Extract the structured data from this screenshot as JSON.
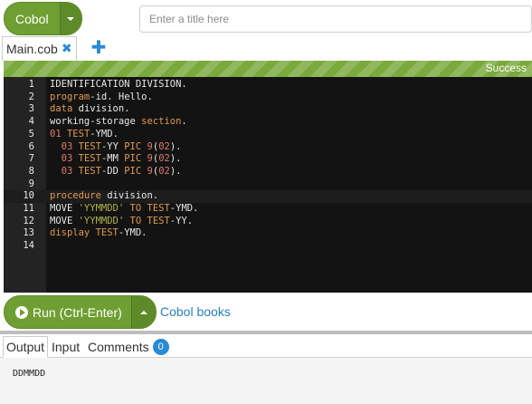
{
  "toolbar": {
    "language_label": "Cobol",
    "title_placeholder": "Enter a title here"
  },
  "tabs": {
    "file_name": "Main.cob",
    "close_glyph": "✖",
    "add_glyph": "✚"
  },
  "status": {
    "text": "Success",
    "color": "#7aa93c"
  },
  "editor": {
    "line_numbers": [
      "1",
      "2",
      "3",
      "4",
      "5",
      "6",
      "7",
      "8",
      "9",
      "10",
      "11",
      "12",
      "13",
      "14"
    ],
    "active_line": 10
  },
  "run": {
    "label": "Run (Ctrl-Enter)",
    "books_link": "Cobol books"
  },
  "output_tabs": {
    "output": "Output",
    "input": "Input",
    "comments": "Comments",
    "comments_count": "0"
  },
  "output": {
    "text": "DDMMDD"
  },
  "icons": {
    "run": "play-circle-icon",
    "dropdown": "caret-down-icon",
    "dropup": "caret-up-icon",
    "close": "close-icon",
    "add": "plus-icon"
  }
}
